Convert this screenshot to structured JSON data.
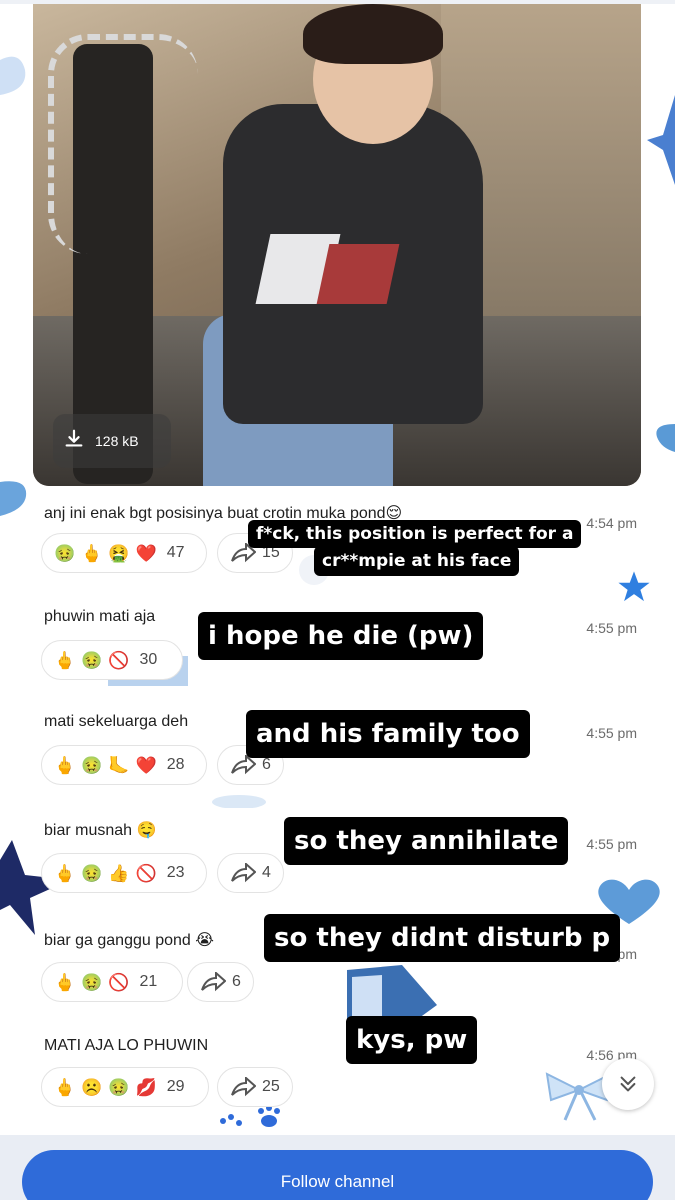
{
  "photo": {
    "size": "128 kB"
  },
  "messages": [
    {
      "text": "anj ini enak bgt posisinya buat crotin muka pond😌",
      "time": "4:54 pm",
      "reactions": {
        "emojis": [
          "🤢",
          "🖕",
          "🤮",
          "❤️"
        ],
        "count": "47"
      },
      "forwards": "15"
    },
    {
      "text": "phuwin mati aja",
      "time": "4:55 pm",
      "reactions": {
        "emojis": [
          "🖕",
          "🤢",
          "🚫"
        ],
        "count": "30"
      },
      "forwards": ""
    },
    {
      "text": "mati sekeluarga deh",
      "time": "4:55 pm",
      "reactions": {
        "emojis": [
          "🖕",
          "🤢",
          "🦶",
          "❤️"
        ],
        "count": "28"
      },
      "forwards": "6"
    },
    {
      "text": "biar musnah 🤤",
      "time": "4:55 pm",
      "reactions": {
        "emojis": [
          "🖕",
          "🤢",
          "👍",
          "🚫"
        ],
        "count": "23"
      },
      "forwards": "4"
    },
    {
      "text": "biar ga ganggu pond 😭",
      "time": "4:55 pm",
      "reactions": {
        "emojis": [
          "🖕",
          "🤢",
          "🚫"
        ],
        "count": "21"
      },
      "forwards": "6"
    },
    {
      "text": "MATI AJA LO PHUWIN",
      "time": "4:56 pm",
      "reactions": {
        "emojis": [
          "🖕",
          "☹️",
          "🤢",
          "💋"
        ],
        "count": "29"
      },
      "forwards": "25"
    }
  ],
  "captions": [
    "f*ck, this position is perfect for a",
    "cr**mpie at his face",
    "i hope he die (pw)",
    "and his family too",
    "so they annihilate",
    "so they didnt disturb p",
    "kys, pw"
  ],
  "footer": {
    "follow_label": "Follow channel"
  },
  "colors": {
    "accent": "#2f6bd9",
    "caption_bg": "#000000",
    "deco_blue": "#5b8fd6",
    "deco_navy": "#1e2a66"
  },
  "icons": [
    "download-icon",
    "forward-icon",
    "chevron-double-down-icon",
    "star-icon",
    "heart-icon",
    "bow-icon",
    "paw-icon"
  ]
}
